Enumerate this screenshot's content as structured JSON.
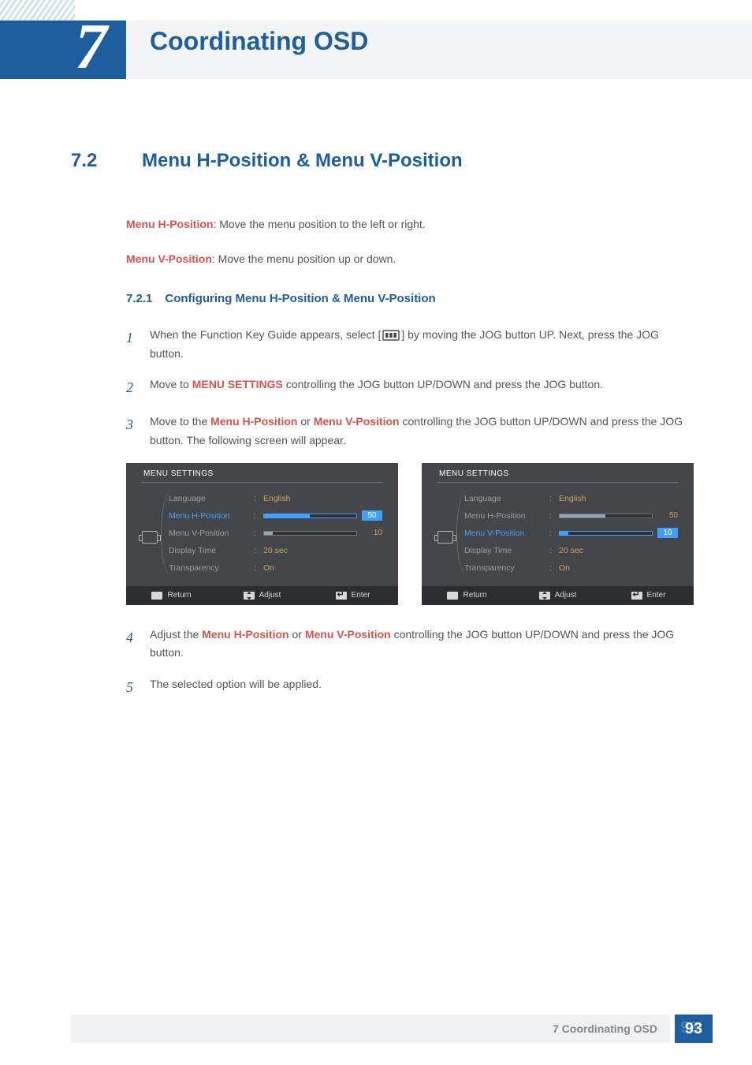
{
  "chapter": {
    "number": "7",
    "title": "Coordinating OSD"
  },
  "section": {
    "number": "7.2",
    "title": "Menu H-Position & Menu V-Position"
  },
  "intro": {
    "h_label": "Menu H-Position",
    "h_desc": ": Move the menu position to the left or right.",
    "v_label": "Menu V-Position",
    "v_desc": ": Move the menu position up or down."
  },
  "subsection": {
    "number": "7.2.1",
    "title": "Configuring Menu H-Position & Menu V-Position"
  },
  "steps": {
    "s1a": "When the Function Key Guide appears, select ",
    "s1b": " by moving the JOG button UP. Next, press the JOG button.",
    "s2a": "Move to ",
    "s2b": "MENU SETTINGS",
    "s2c": " controlling the JOG button UP/DOWN and press the JOG button.",
    "s3a": "Move to the ",
    "s3b": "Menu H-Position",
    "s3c": " or ",
    "s3d": "Menu V-Position",
    "s3e": " controlling the JOG button UP/DOWN and press the JOG button. The following screen will appear.",
    "s4a": "Adjust the ",
    "s4b": "Menu H-Position",
    "s4c": " or ",
    "s4d": "Menu V-Position",
    "s4e": " controlling the JOG button UP/DOWN and press the JOG button.",
    "s5": "The selected option will be applied."
  },
  "osd": {
    "title": "MENU SETTINGS",
    "rows": {
      "language": {
        "label": "Language",
        "value": "English"
      },
      "hpos": {
        "label": "Menu H-Position",
        "value": "50"
      },
      "vpos": {
        "label": "Menu V-Position",
        "value": "10"
      },
      "display_time": {
        "label": "Display Time",
        "value": "20 sec"
      },
      "transparency": {
        "label": "Transparency",
        "value": "On"
      }
    },
    "footer": {
      "return": "Return",
      "adjust": "Adjust",
      "enter": "Enter"
    }
  },
  "footer": {
    "text": "7 Coordinating OSD",
    "page": "93"
  }
}
